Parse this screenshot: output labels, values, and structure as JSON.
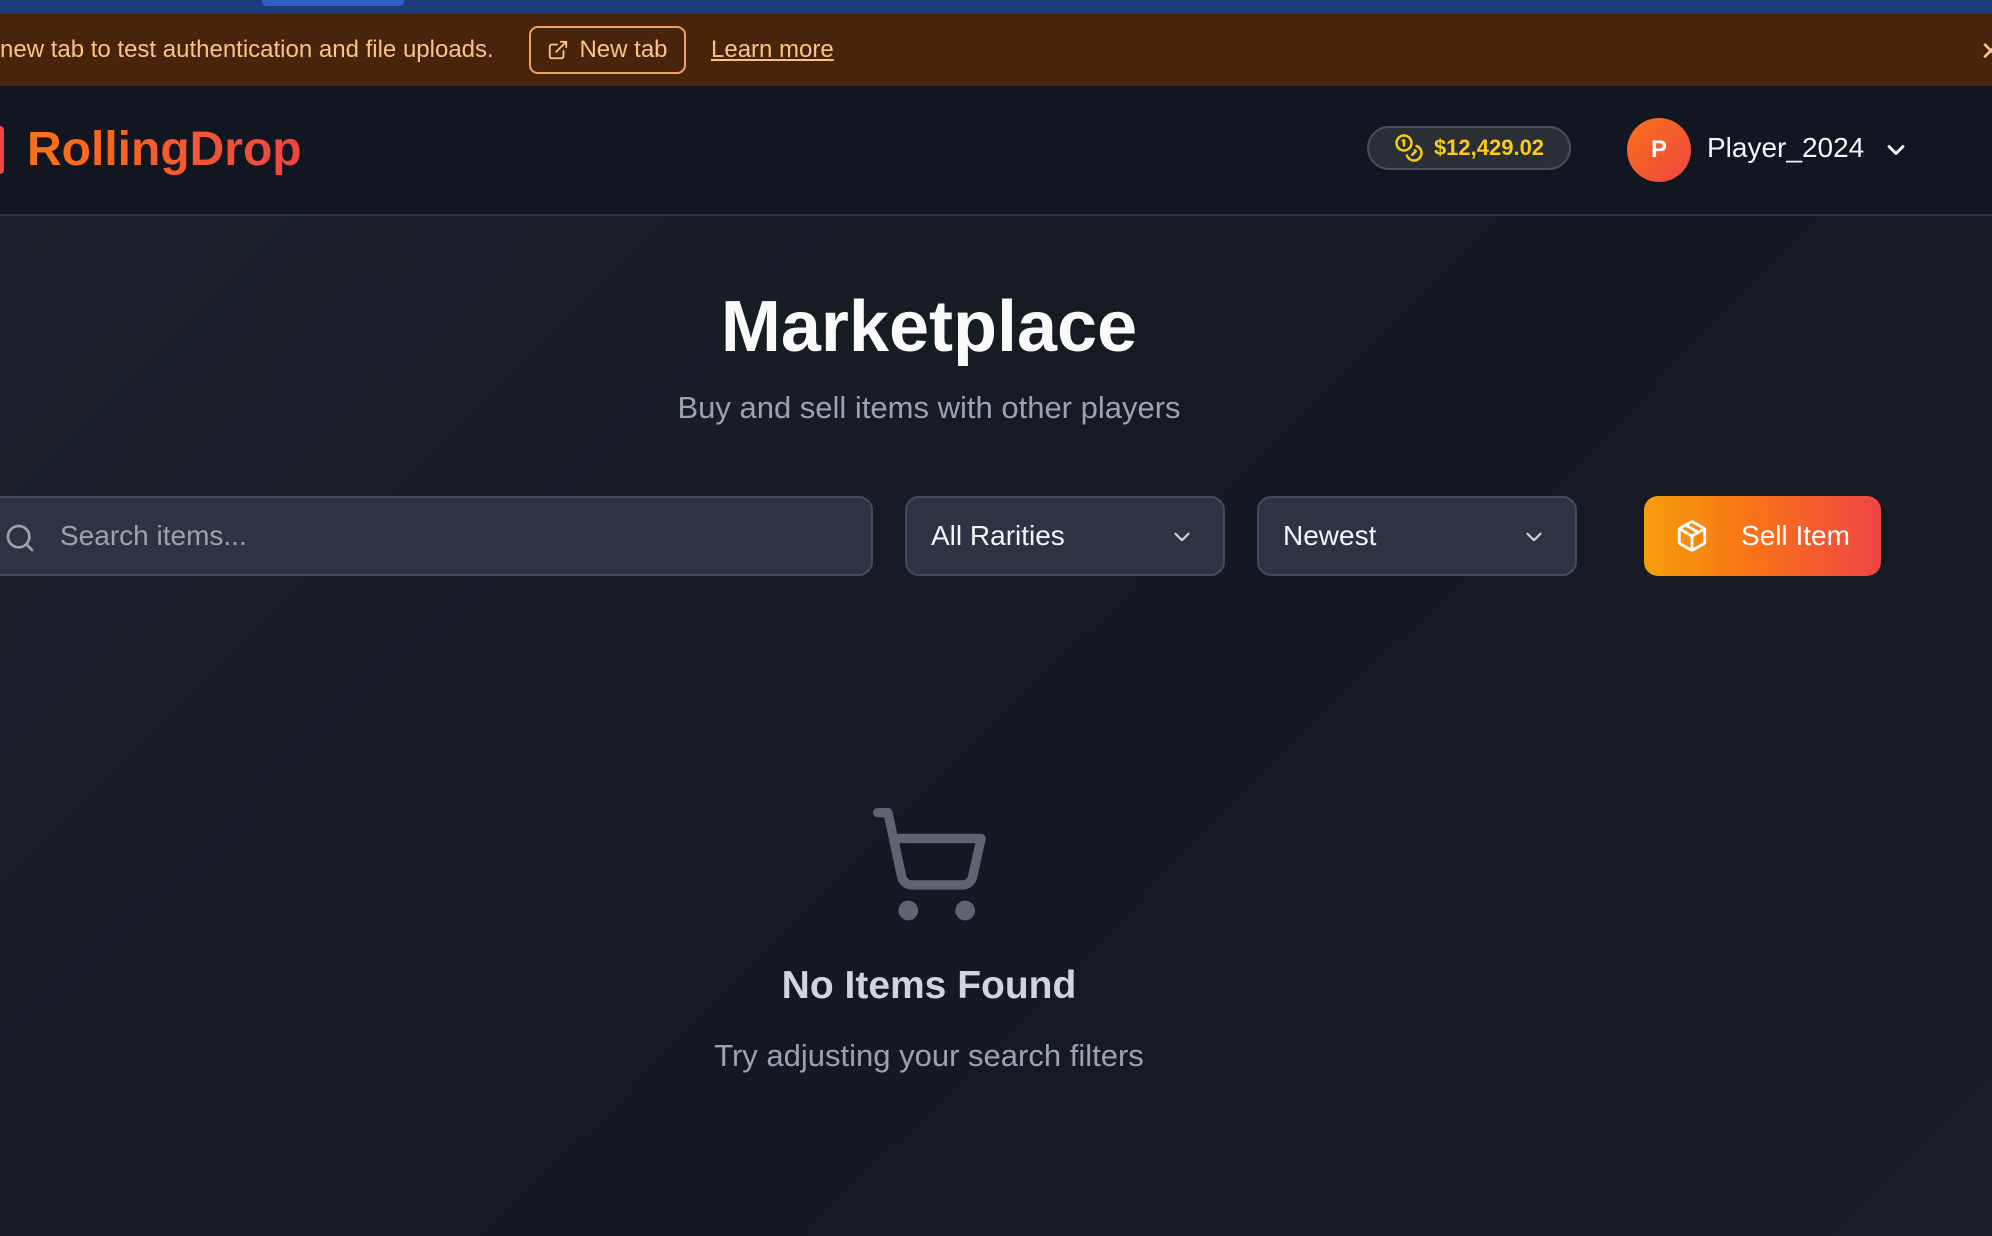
{
  "banner": {
    "message": "new tab to test authentication and file uploads.",
    "new_tab_label": "New tab",
    "learn_more_label": "Learn more",
    "close_glyph": "✕"
  },
  "header": {
    "brand": "RollingDrop",
    "balance": "$12,429.02",
    "avatar_initial": "P",
    "username": "Player_2024"
  },
  "page": {
    "title": "Marketplace",
    "subtitle": "Buy and sell items with other players"
  },
  "filters": {
    "search_placeholder": "Search items...",
    "rarity_selected": "All Rarities",
    "sort_selected": "Newest",
    "sell_label": "Sell Item"
  },
  "empty_state": {
    "title": "No Items Found",
    "message": "Try adjusting your search filters"
  },
  "colors": {
    "accent_start": "#f97316",
    "accent_end": "#ef4444",
    "balance": "#facc15",
    "banner_bg": "#48240c"
  },
  "icons": [
    "external-link-icon",
    "close-icon",
    "coins-icon",
    "chevron-down-icon",
    "search-icon",
    "package-icon",
    "shopping-cart-icon"
  ]
}
